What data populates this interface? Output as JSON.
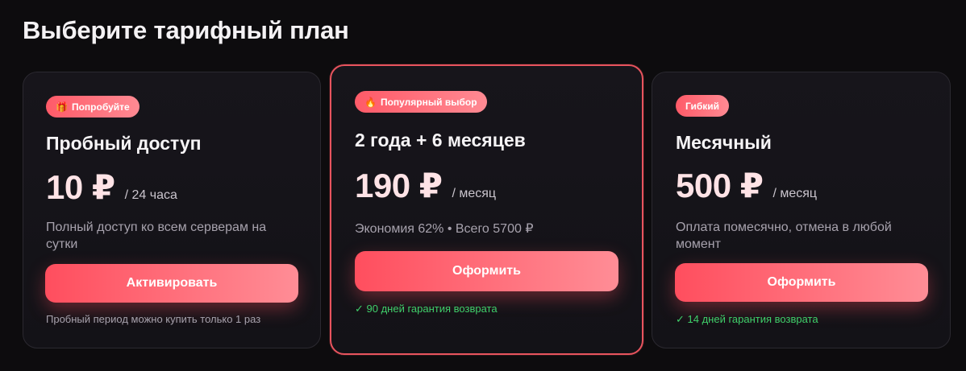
{
  "page": {
    "title": "Выберите тарифный план"
  },
  "colors": {
    "accent": "#ff5a68",
    "highlight_border": "#e8545e",
    "success": "#3fcf6a",
    "background": "#0d0c0e",
    "card": "#16151a"
  },
  "plans": [
    {
      "badge_icon": "gift-icon",
      "badge_glyph": "🎁",
      "badge": "Попробуйте",
      "name": "Пробный доступ",
      "price": "10 ₽",
      "period": "/ 24 часа",
      "description": "Полный доступ ко всем серверам на сутки",
      "button": "Активировать",
      "note": "Пробный период можно купить только 1 раз"
    },
    {
      "badge_icon": "fire-icon",
      "badge_glyph": "🔥",
      "badge": "Популярный выбор",
      "name": "2 года + 6 месяцев",
      "price": "190 ₽",
      "period": "/ месяц",
      "description": "Экономия 62% • Всего 5700 ₽",
      "button": "Оформить",
      "note": "✓ 90 дней гарантия возврата"
    },
    {
      "badge": "Гибкий",
      "name": "Месячный",
      "price": "500 ₽",
      "period": "/ месяц",
      "description": "Оплата помесячно, отмена в любой момент",
      "button": "Оформить",
      "note": "✓ 14 дней гарантия возврата"
    }
  ]
}
